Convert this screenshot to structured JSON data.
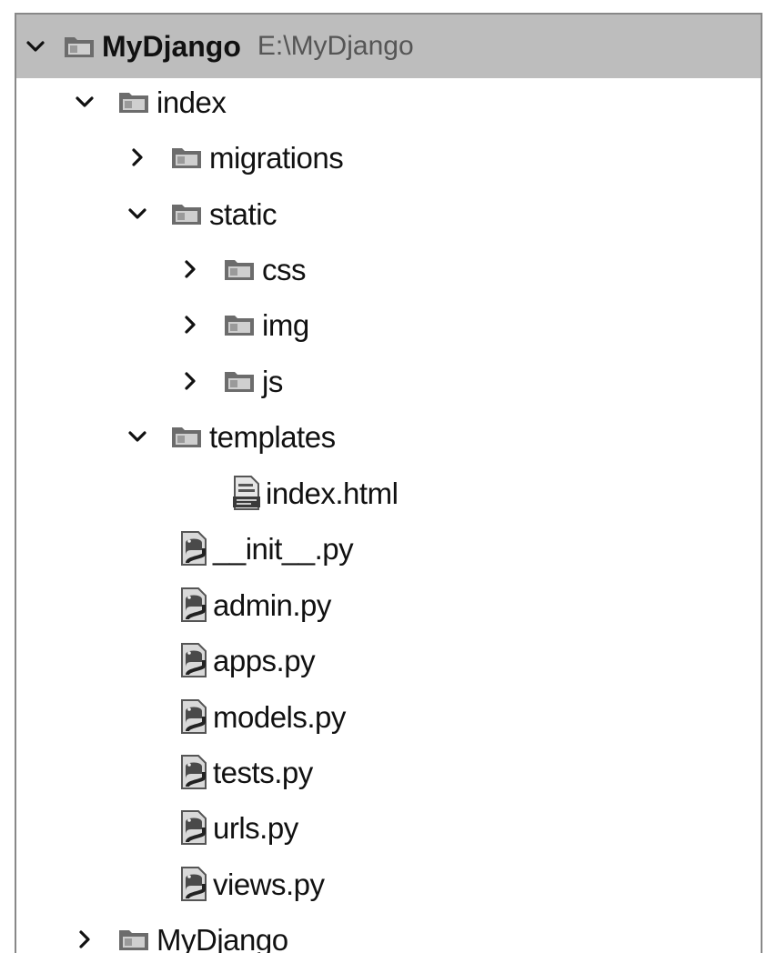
{
  "tree": {
    "root": {
      "name": "MyDjango",
      "path": "E:\\MyDjango",
      "expanded": true
    },
    "items": [
      {
        "label": "index",
        "type": "folder",
        "expanded": true
      },
      {
        "label": "migrations",
        "type": "folder",
        "expanded": false
      },
      {
        "label": "static",
        "type": "folder",
        "expanded": true
      },
      {
        "label": "css",
        "type": "folder",
        "expanded": false
      },
      {
        "label": "img",
        "type": "folder",
        "expanded": false
      },
      {
        "label": "js",
        "type": "folder",
        "expanded": false
      },
      {
        "label": "templates",
        "type": "folder",
        "expanded": true
      },
      {
        "label": "index.html",
        "type": "html-file"
      },
      {
        "label": "__init__.py",
        "type": "python-file"
      },
      {
        "label": "admin.py",
        "type": "python-file"
      },
      {
        "label": "apps.py",
        "type": "python-file"
      },
      {
        "label": "models.py",
        "type": "python-file"
      },
      {
        "label": "tests.py",
        "type": "python-file"
      },
      {
        "label": "urls.py",
        "type": "python-file"
      },
      {
        "label": "views.py",
        "type": "python-file"
      },
      {
        "label": "MyDjango",
        "type": "folder",
        "expanded": false
      }
    ]
  }
}
